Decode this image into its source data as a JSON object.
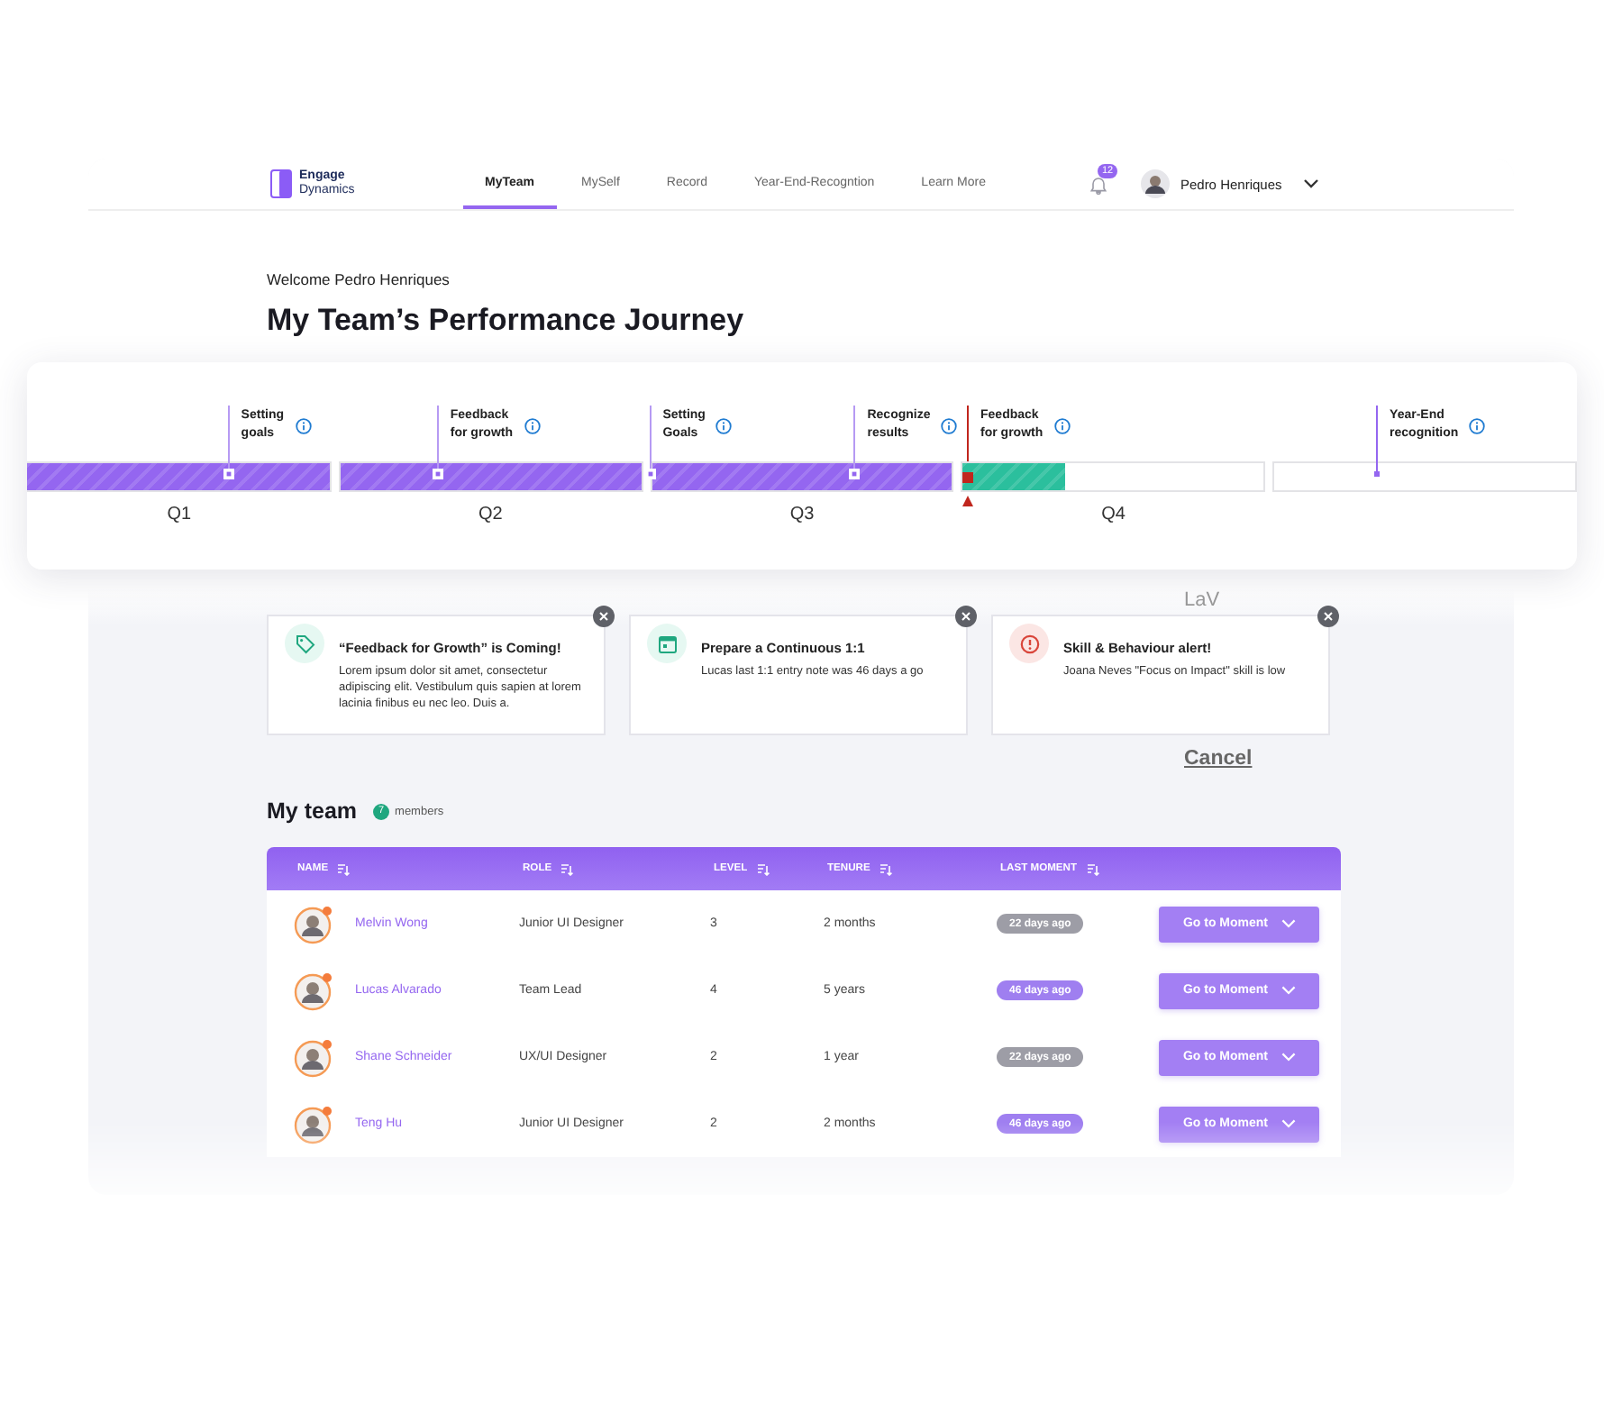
{
  "nav": {
    "logo_top": "Engage",
    "logo_bottom": "Dynamics",
    "tabs": [
      {
        "label": "MyTeam",
        "selected": true
      },
      {
        "label": "MySelf",
        "selected": false
      },
      {
        "label": "Record",
        "selected": false
      },
      {
        "label": "Year-End-Recogntion",
        "selected": false
      },
      {
        "label": "Learn More",
        "selected": false
      }
    ],
    "notifications": "12",
    "user": "Pedro Henriques"
  },
  "welcome": "Welcome Pedro Henriques",
  "title": "My Team’s Performance Journey",
  "timeline": {
    "segments": [
      {
        "label": "Q1",
        "level": 1,
        "color": "#9466f0"
      },
      {
        "label": "Q2",
        "level": 1,
        "color": "#9466f0"
      },
      {
        "label": "Q3",
        "level": 1,
        "color": "#9466f0"
      },
      {
        "label": "Q4",
        "level": 0.34,
        "color": "#2bbf9d"
      }
    ],
    "milestones": [
      {
        "lines": [
          "Setting",
          "goals"
        ],
        "kind": "done"
      },
      {
        "lines": [
          "Feedback",
          "for growth"
        ],
        "kind": "done"
      },
      {
        "lines": [
          "Setting",
          "Goals"
        ],
        "kind": "done"
      },
      {
        "lines": [
          "Recognize",
          "results"
        ],
        "kind": "done"
      },
      {
        "lines": [
          "Feedback",
          "for growth"
        ],
        "kind": "current"
      },
      {
        "lines": [
          "Year-End",
          "recognition"
        ],
        "kind": "upcoming"
      }
    ]
  },
  "floating_text": "LaV",
  "alerts": [
    {
      "kind": "tag",
      "title": "“Feedback for Growth” is Coming!",
      "body": "Lorem ipsum dolor sit amet, consectetur adipiscing elit. Vestibulum quis sapien at lorem lacinia finibus eu nec leo. Duis a."
    },
    {
      "kind": "calendar",
      "title": "Prepare a Continuous 1:1",
      "body": "Lucas last 1:1 entry note was 46 days a go"
    },
    {
      "kind": "alert",
      "title": "Skill & Behaviour alert!",
      "body": "Joana Neves \"Focus on Impact\" skill is low"
    }
  ],
  "cancel": "Cancel",
  "team": {
    "title": "My team",
    "count": "7",
    "count_label": "members",
    "columns": [
      "NAME",
      "ROLE",
      "LEVEL",
      "TENURE",
      "LAST MOMENT"
    ],
    "rows": [
      {
        "name": "Melvin Wong",
        "role": "Junior UI Designer",
        "grade": "3",
        "tenure": "2 months",
        "last_moment": "22 days ago",
        "color": "#9d9da6",
        "action": "Go to Moment"
      },
      {
        "name": "Lucas Alvarado",
        "role": "Team Lead",
        "grade": "4",
        "tenure": "5 years",
        "last_moment": "46 days ago",
        "color": "#9f7ff0",
        "action": "Go to Moment"
      },
      {
        "name": "Shane Schneider",
        "role": "UX/UI Designer",
        "grade": "2",
        "tenure": "1 year",
        "last_moment": "22 days ago",
        "color": "#9d9da6",
        "action": "Go to Moment"
      },
      {
        "name": "Teng Hu",
        "role": "Junior UI Designer",
        "grade": "2",
        "tenure": "2 months",
        "last_moment": "46 days ago",
        "color": "#9f7ff0",
        "action": "Go to Moment"
      }
    ]
  }
}
